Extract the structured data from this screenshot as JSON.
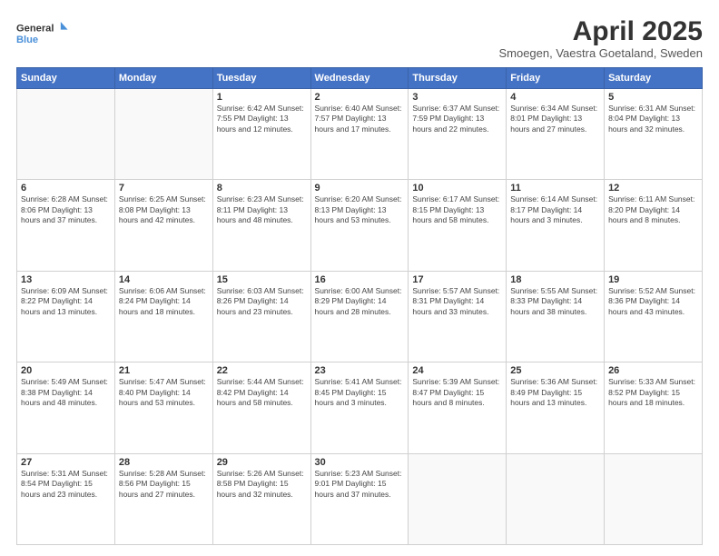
{
  "header": {
    "logo_line1": "General",
    "logo_line2": "Blue",
    "title": "April 2025",
    "subtitle": "Smoegen, Vaestra Goetaland, Sweden"
  },
  "days_of_week": [
    "Sunday",
    "Monday",
    "Tuesday",
    "Wednesday",
    "Thursday",
    "Friday",
    "Saturday"
  ],
  "weeks": [
    [
      {
        "day": "",
        "info": ""
      },
      {
        "day": "",
        "info": ""
      },
      {
        "day": "1",
        "info": "Sunrise: 6:42 AM\nSunset: 7:55 PM\nDaylight: 13 hours and 12 minutes."
      },
      {
        "day": "2",
        "info": "Sunrise: 6:40 AM\nSunset: 7:57 PM\nDaylight: 13 hours and 17 minutes."
      },
      {
        "day": "3",
        "info": "Sunrise: 6:37 AM\nSunset: 7:59 PM\nDaylight: 13 hours and 22 minutes."
      },
      {
        "day": "4",
        "info": "Sunrise: 6:34 AM\nSunset: 8:01 PM\nDaylight: 13 hours and 27 minutes."
      },
      {
        "day": "5",
        "info": "Sunrise: 6:31 AM\nSunset: 8:04 PM\nDaylight: 13 hours and 32 minutes."
      }
    ],
    [
      {
        "day": "6",
        "info": "Sunrise: 6:28 AM\nSunset: 8:06 PM\nDaylight: 13 hours and 37 minutes."
      },
      {
        "day": "7",
        "info": "Sunrise: 6:25 AM\nSunset: 8:08 PM\nDaylight: 13 hours and 42 minutes."
      },
      {
        "day": "8",
        "info": "Sunrise: 6:23 AM\nSunset: 8:11 PM\nDaylight: 13 hours and 48 minutes."
      },
      {
        "day": "9",
        "info": "Sunrise: 6:20 AM\nSunset: 8:13 PM\nDaylight: 13 hours and 53 minutes."
      },
      {
        "day": "10",
        "info": "Sunrise: 6:17 AM\nSunset: 8:15 PM\nDaylight: 13 hours and 58 minutes."
      },
      {
        "day": "11",
        "info": "Sunrise: 6:14 AM\nSunset: 8:17 PM\nDaylight: 14 hours and 3 minutes."
      },
      {
        "day": "12",
        "info": "Sunrise: 6:11 AM\nSunset: 8:20 PM\nDaylight: 14 hours and 8 minutes."
      }
    ],
    [
      {
        "day": "13",
        "info": "Sunrise: 6:09 AM\nSunset: 8:22 PM\nDaylight: 14 hours and 13 minutes."
      },
      {
        "day": "14",
        "info": "Sunrise: 6:06 AM\nSunset: 8:24 PM\nDaylight: 14 hours and 18 minutes."
      },
      {
        "day": "15",
        "info": "Sunrise: 6:03 AM\nSunset: 8:26 PM\nDaylight: 14 hours and 23 minutes."
      },
      {
        "day": "16",
        "info": "Sunrise: 6:00 AM\nSunset: 8:29 PM\nDaylight: 14 hours and 28 minutes."
      },
      {
        "day": "17",
        "info": "Sunrise: 5:57 AM\nSunset: 8:31 PM\nDaylight: 14 hours and 33 minutes."
      },
      {
        "day": "18",
        "info": "Sunrise: 5:55 AM\nSunset: 8:33 PM\nDaylight: 14 hours and 38 minutes."
      },
      {
        "day": "19",
        "info": "Sunrise: 5:52 AM\nSunset: 8:36 PM\nDaylight: 14 hours and 43 minutes."
      }
    ],
    [
      {
        "day": "20",
        "info": "Sunrise: 5:49 AM\nSunset: 8:38 PM\nDaylight: 14 hours and 48 minutes."
      },
      {
        "day": "21",
        "info": "Sunrise: 5:47 AM\nSunset: 8:40 PM\nDaylight: 14 hours and 53 minutes."
      },
      {
        "day": "22",
        "info": "Sunrise: 5:44 AM\nSunset: 8:42 PM\nDaylight: 14 hours and 58 minutes."
      },
      {
        "day": "23",
        "info": "Sunrise: 5:41 AM\nSunset: 8:45 PM\nDaylight: 15 hours and 3 minutes."
      },
      {
        "day": "24",
        "info": "Sunrise: 5:39 AM\nSunset: 8:47 PM\nDaylight: 15 hours and 8 minutes."
      },
      {
        "day": "25",
        "info": "Sunrise: 5:36 AM\nSunset: 8:49 PM\nDaylight: 15 hours and 13 minutes."
      },
      {
        "day": "26",
        "info": "Sunrise: 5:33 AM\nSunset: 8:52 PM\nDaylight: 15 hours and 18 minutes."
      }
    ],
    [
      {
        "day": "27",
        "info": "Sunrise: 5:31 AM\nSunset: 8:54 PM\nDaylight: 15 hours and 23 minutes."
      },
      {
        "day": "28",
        "info": "Sunrise: 5:28 AM\nSunset: 8:56 PM\nDaylight: 15 hours and 27 minutes."
      },
      {
        "day": "29",
        "info": "Sunrise: 5:26 AM\nSunset: 8:58 PM\nDaylight: 15 hours and 32 minutes."
      },
      {
        "day": "30",
        "info": "Sunrise: 5:23 AM\nSunset: 9:01 PM\nDaylight: 15 hours and 37 minutes."
      },
      {
        "day": "",
        "info": ""
      },
      {
        "day": "",
        "info": ""
      },
      {
        "day": "",
        "info": ""
      }
    ]
  ]
}
